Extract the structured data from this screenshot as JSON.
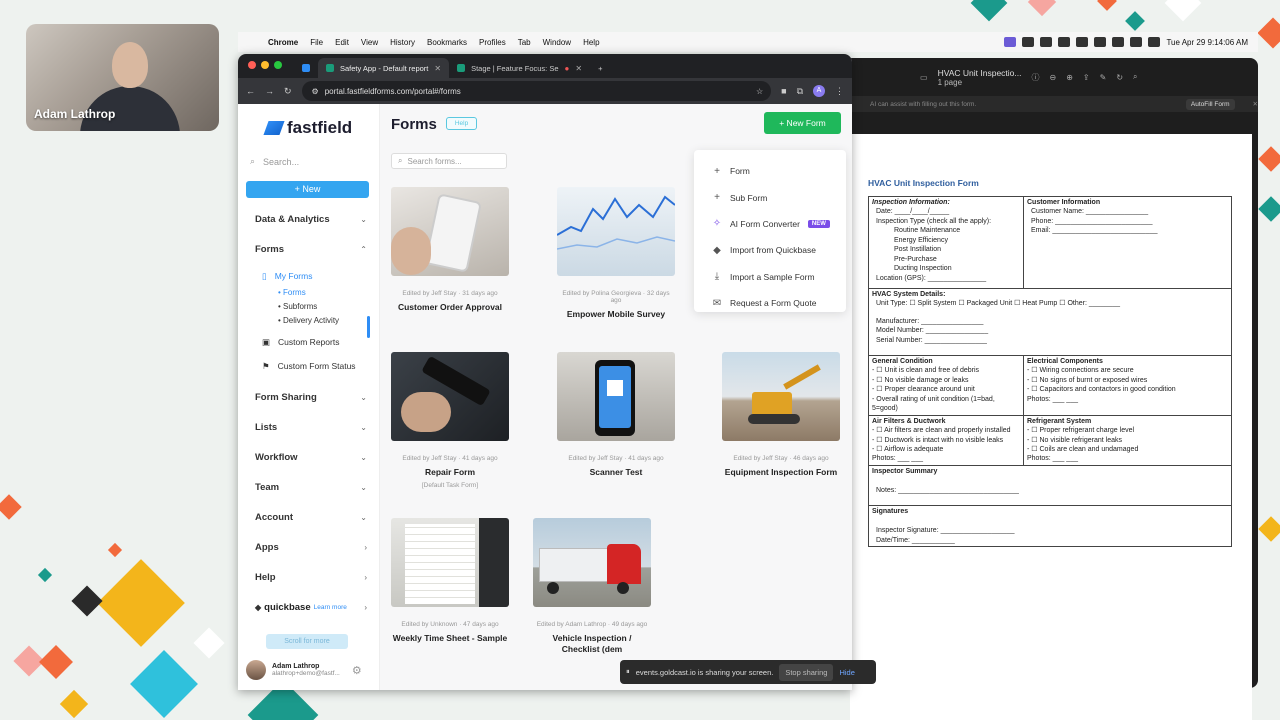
{
  "webcam": {
    "name": "Adam Lathrop"
  },
  "menubar": {
    "items": [
      "Chrome",
      "File",
      "Edit",
      "View",
      "History",
      "Bookmarks",
      "Profiles",
      "Tab",
      "Window",
      "Help"
    ],
    "clock": "Tue Apr 29  9:14:06 AM"
  },
  "browser": {
    "tabs": [
      "Safety App - Default report",
      "Stage | Feature Focus: Se"
    ],
    "url": "portal.fastfieldforms.com/portal#/forms",
    "profile_initial": "A"
  },
  "sidebar": {
    "logo": "fastfield",
    "search_placeholder": "Search...",
    "new_label": "+ New",
    "sections": {
      "data_analytics": "Data & Analytics",
      "forms": "Forms",
      "my_forms": "My Forms",
      "forms_sub": "• Forms",
      "subforms": "• Subforms",
      "delivery": "• Delivery Activity",
      "custom_reports": "Custom Reports",
      "custom_form_status": "Custom Form Status",
      "form_sharing": "Form Sharing",
      "lists": "Lists",
      "workflow": "Workflow",
      "team": "Team",
      "account": "Account",
      "apps": "Apps",
      "help": "Help",
      "quickbase": "quickbase",
      "learn_more": "Learn more"
    },
    "scroll_more": "Scroll for more",
    "user": {
      "name": "Adam Lathrop",
      "email": "alathrop+demo@fastf..."
    }
  },
  "main": {
    "title": "Forms",
    "help_label": "Help",
    "new_form_label": "+ New Form",
    "search_placeholder": "Search forms...",
    "cards": [
      {
        "edited": "Edited by Jeff Stay · 31 days ago",
        "title": "Customer Order Approval",
        "subtitle": ""
      },
      {
        "edited": "Edited by Polina Georgieva · 32 days ago",
        "title": "Empower Mobile Survey",
        "subtitle": ""
      },
      {
        "edited": "Edited by Jeff Stay · 41 days ago",
        "title": "Repair Form",
        "subtitle": "[Default Task Form]"
      },
      {
        "edited": "Edited by Jeff Stay · 41 days ago",
        "title": "Scanner Test",
        "subtitle": ""
      },
      {
        "edited": "Edited by Jeff Stay · 46 days ago",
        "title": "Equipment Inspection Form",
        "subtitle": ""
      },
      {
        "edited": "Edited by Unknown · 47 days ago",
        "title": "Weekly Time Sheet - Sample",
        "subtitle": ""
      },
      {
        "edited": "Edited by Adam Lathrop · 49 days ago",
        "title": "Vehicle Inspection / Checklist (dem",
        "subtitle": ""
      }
    ]
  },
  "dropdown": {
    "items": [
      "Form",
      "Sub Form",
      "AI Form Converter",
      "Import from Quickbase",
      "Import a Sample Form",
      "Request a Form Quote"
    ],
    "new_badge": "NEW"
  },
  "pdf": {
    "window_title": "HVAC Unit Inspectio...",
    "pages": "1 page",
    "notice": "AI can assist with filling out this form.",
    "autofill_label": "AutoFill Form",
    "doc_title": "HVAC Unit Inspection Form",
    "inspection_info": {
      "heading": "Inspection Information:",
      "date": "Date: ____/____/_____",
      "type": "Inspection Type (check all the apply):",
      "types": [
        "Routine Maintenance",
        "Energy Efficiency",
        "Post Instillation",
        "Pre-Purchase",
        "Ducting Inspection"
      ],
      "location": "Location (GPS): _______________"
    },
    "customer_info": {
      "heading": "Customer Information",
      "name": "Customer Name: ________________",
      "phone": "Phone: _________________________",
      "email": "Email: ___________________________"
    },
    "system_details": {
      "heading": "HVAC System Details:",
      "unit_type": "Unit Type: ☐ Split System ☐ Packaged Unit ☐ Heat Pump ☐ Other: ________",
      "manufacturer": "Manufacturer: ________________",
      "model": "Model Number: ________________",
      "serial": "Serial Number: ________________"
    },
    "general": {
      "heading": "General Condition",
      "items": [
        "- ☐ Unit is clean and free of debris",
        "- ☐ No visible damage or leaks",
        "- ☐ Proper clearance around unit",
        "- Overall rating of unit condition (1=bad, 5=good)"
      ]
    },
    "electrical": {
      "heading": "Electrical Components",
      "items": [
        "- ☐ Wiring connections are secure",
        "- ☐ No signs of burnt or exposed wires",
        "- ☐ Capacitors and contactors in good condition",
        "Photos: ___ ___"
      ]
    },
    "filters": {
      "heading": "Air Filters & Ductwork",
      "items": [
        "- ☐ Air filters are clean and properly installed",
        "- ☐ Ductwork is intact with no visible leaks",
        "- ☐ Airflow is adequate",
        "Photos: ___ ___"
      ]
    },
    "refrigerant": {
      "heading": "Refrigerant System",
      "items": [
        "- ☐ Proper refrigerant charge level",
        "- ☐ No visible refrigerant leaks",
        "- ☐ Coils are clean and undamaged",
        "Photos: ___ ___"
      ]
    },
    "summary": {
      "heading": "Inspector Summary",
      "notes": "Notes: _______________________________"
    },
    "signatures": {
      "heading": "Signatures",
      "sig": "Inspector Signature: ___________________",
      "date": "Date/Time: ___________"
    }
  },
  "sharebar": {
    "message": "events.goldcast.io is sharing your screen.",
    "stop_label": "Stop sharing",
    "hide_label": "Hide"
  }
}
